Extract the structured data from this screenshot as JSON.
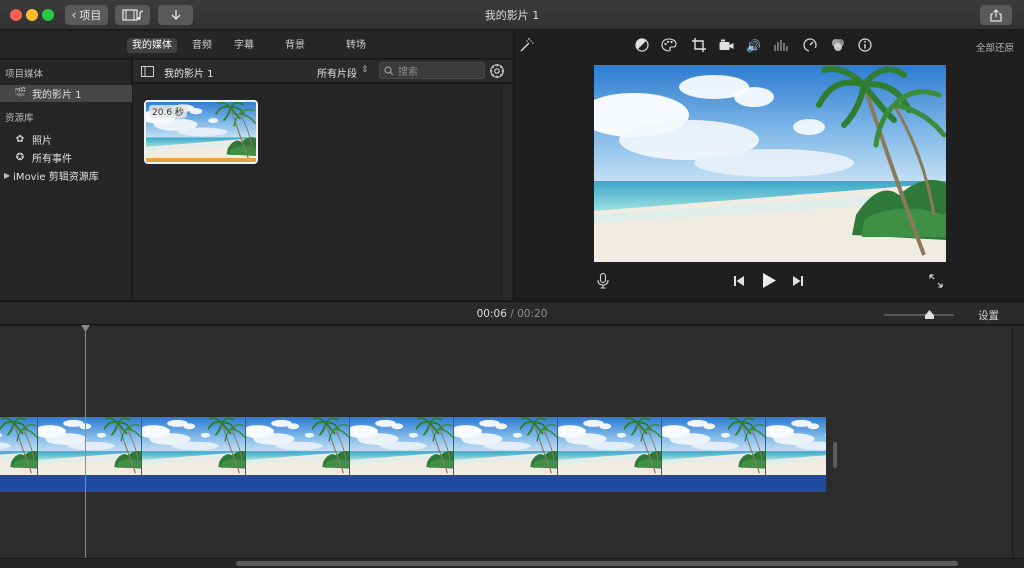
{
  "window": {
    "title": "我的影片 1"
  },
  "toolbar": {
    "back_label": "项目"
  },
  "browser_tabs": [
    {
      "label": "我的媒体",
      "active": true
    },
    {
      "label": "音频",
      "active": false
    },
    {
      "label": "字幕",
      "active": false
    },
    {
      "label": "背景",
      "active": false
    },
    {
      "label": "转场",
      "active": false
    }
  ],
  "sidebar": {
    "project_media_heading": "项目媒体",
    "project_item": "我的影片 1",
    "libraries_heading": "资源库",
    "photos_item": "照片",
    "all_events_item": "所有事件",
    "imovie_library_item": "iMovie 剪辑资源库"
  },
  "media_browser": {
    "title": "我的影片 1",
    "filter": "所有片段",
    "search_placeholder": "搜索",
    "clip_duration": "20.6 秒"
  },
  "viewer": {
    "reset_all": "全部还原",
    "icons": [
      "magic-wand-icon",
      "color-balance-icon",
      "color-palette-icon",
      "crop-icon",
      "camera-stabilization-icon",
      "volume-icon",
      "noise-equalizer-icon",
      "speed-icon",
      "clip-filter-icon",
      "info-icon"
    ]
  },
  "timeline": {
    "current_time": "00:06",
    "separator": "/",
    "total_duration": "00:20",
    "settings_label": "设置",
    "zoom_level": 0.62
  },
  "colors": {
    "audio_track": "#1e4c9f",
    "clip_selection": "#e3a340",
    "background": "#1e1e1e"
  }
}
